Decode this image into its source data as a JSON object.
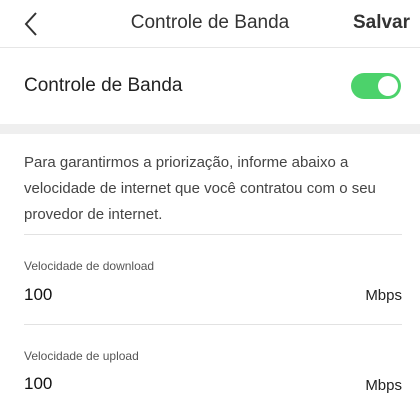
{
  "header": {
    "title": "Controle de Banda",
    "save_label": "Salvar"
  },
  "toggle": {
    "label": "Controle de Banda",
    "enabled": true,
    "color": "#4cd26b"
  },
  "info_text": "Para garantirmos a priorização, informe abaixo a velocidade de internet que você contratou com o seu provedor de internet.",
  "download": {
    "label": "Velocidade de download",
    "value": "100",
    "unit": "Mbps"
  },
  "upload": {
    "label": "Velocidade de upload",
    "value": "100",
    "unit": "Mbps"
  }
}
